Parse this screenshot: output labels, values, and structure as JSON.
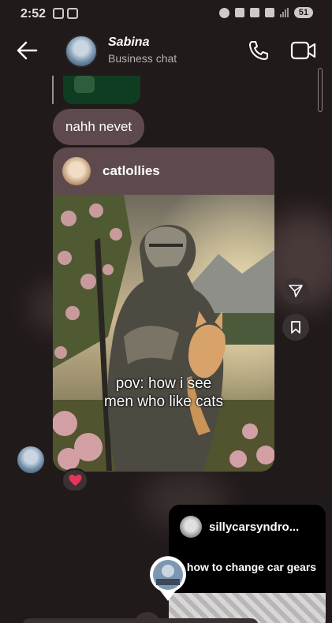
{
  "status_bar": {
    "time": "2:52",
    "battery": "51"
  },
  "header": {
    "title": "Sabina",
    "subtitle": "Business chat"
  },
  "messages": [
    {
      "text": "nahh nevet"
    }
  ],
  "post": {
    "username": "catlollies",
    "caption_line1": "pov: how i see",
    "caption_line2": "men who like cats"
  },
  "reel": {
    "username": "sillycarsyndro...",
    "caption": "how to change car gears"
  },
  "reaction": "heart",
  "colors": {
    "bubble": "#5e4a4c",
    "background": "#211a1a",
    "reel_card": "#000000",
    "heart": "#e8345a"
  }
}
